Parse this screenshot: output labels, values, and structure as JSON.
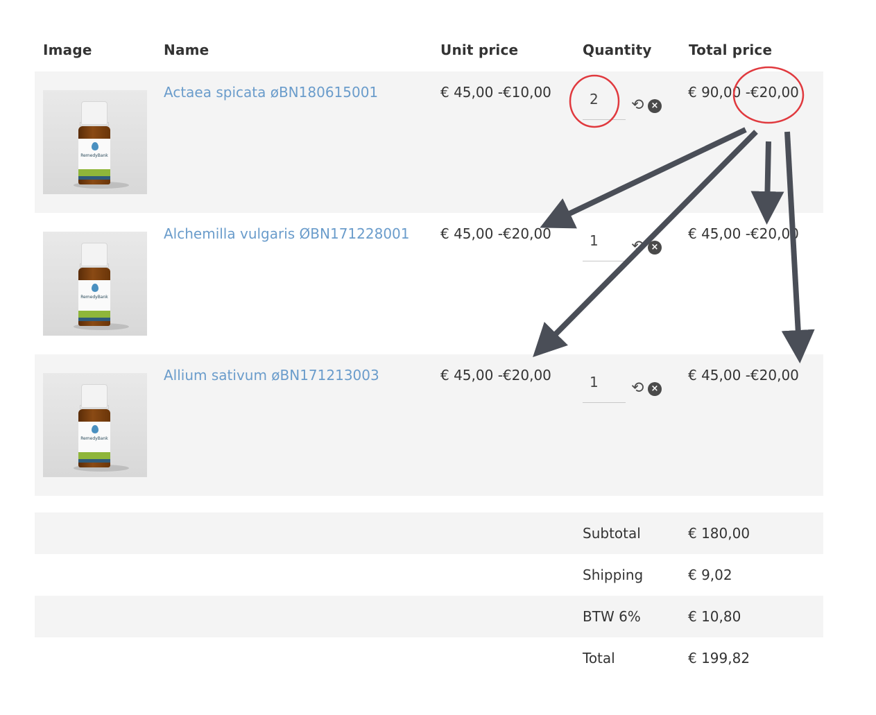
{
  "table": {
    "headers": {
      "image": "Image",
      "name": "Name",
      "unit_price": "Unit price",
      "quantity": "Quantity",
      "total_price": "Total price"
    },
    "rows": [
      {
        "name": "Actaea spicata øBN180615001",
        "unit_price": "€ 45,00 -€10,00",
        "quantity": "2",
        "total": "€ 90,00 -€20,00",
        "brand": "RemedyBank"
      },
      {
        "name": "Alchemilla vulgaris ØBN171228001",
        "unit_price": "€ 45,00 -€20,00",
        "quantity": "1",
        "total": "€ 45,00 -€20,00",
        "brand": "RemedyBank"
      },
      {
        "name": "Allium sativum øBN171213003",
        "unit_price": "€ 45,00 -€20,00",
        "quantity": "1",
        "total": "€ 45,00 -€20,00",
        "brand": "RemedyBank"
      }
    ]
  },
  "summary": [
    {
      "label": "Subtotal",
      "value": "€ 180,00"
    },
    {
      "label": "Shipping",
      "value": "€ 9,02"
    },
    {
      "label": "BTW 6%",
      "value": "€ 10,80"
    },
    {
      "label": "Total",
      "value": "€ 199,82"
    }
  ],
  "icons": {
    "refresh": "refresh-icon",
    "remove": "remove-icon"
  },
  "colors": {
    "link": "#6a9ccb",
    "annotation_circle": "#e0393e",
    "annotation_arrow": "#4a4e57",
    "row_shade": "#f4f4f4"
  }
}
